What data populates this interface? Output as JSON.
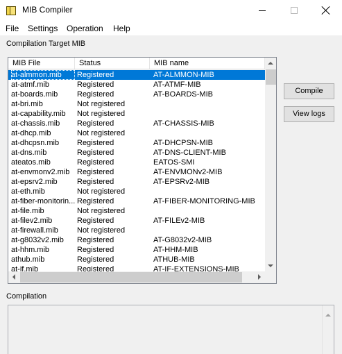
{
  "window": {
    "title": "MIB Compiler",
    "app_icon": "mib-compiler-icon",
    "controls": [
      "minimize-icon",
      "maximize-icon",
      "close-icon"
    ]
  },
  "menu": [
    "File",
    "Settings",
    "Operation",
    "Help"
  ],
  "target_label": "Compilation Target MIB",
  "table": {
    "columns": [
      "MIB File",
      "Status",
      "MIB name"
    ],
    "selected_index": 0,
    "rows": [
      {
        "file": "at-almmon.mib",
        "status": "Registered",
        "name": "AT-ALMMON-MIB"
      },
      {
        "file": "at-atmf.mib",
        "status": "Registered",
        "name": "AT-ATMF-MIB"
      },
      {
        "file": "at-boards.mib",
        "status": "Registered",
        "name": "AT-BOARDS-MIB"
      },
      {
        "file": "at-bri.mib",
        "status": "Not registered",
        "name": ""
      },
      {
        "file": "at-capability.mib",
        "status": "Not registered",
        "name": ""
      },
      {
        "file": "at-chassis.mib",
        "status": "Registered",
        "name": "AT-CHASSIS-MIB"
      },
      {
        "file": "at-dhcp.mib",
        "status": "Not registered",
        "name": ""
      },
      {
        "file": "at-dhcpsn.mib",
        "status": "Registered",
        "name": "AT-DHCPSN-MIB"
      },
      {
        "file": "at-dns.mib",
        "status": "Registered",
        "name": "AT-DNS-CLIENT-MIB"
      },
      {
        "file": "ateatos.mib",
        "status": "Registered",
        "name": "EATOS-SMI"
      },
      {
        "file": "at-envmonv2.mib",
        "status": "Registered",
        "name": "AT-ENVMONv2-MIB"
      },
      {
        "file": "at-epsrv2.mib",
        "status": "Registered",
        "name": "AT-EPSRv2-MIB"
      },
      {
        "file": "at-eth.mib",
        "status": "Not registered",
        "name": ""
      },
      {
        "file": "at-fiber-monitorin...",
        "status": "Registered",
        "name": "AT-FIBER-MONITORING-MIB"
      },
      {
        "file": "at-file.mib",
        "status": "Not registered",
        "name": ""
      },
      {
        "file": "at-filev2.mib",
        "status": "Registered",
        "name": "AT-FILEv2-MIB"
      },
      {
        "file": "at-firewall.mib",
        "status": "Not registered",
        "name": ""
      },
      {
        "file": "at-g8032v2.mib",
        "status": "Registered",
        "name": "AT-G8032v2-MIB"
      },
      {
        "file": "at-hhm.mib",
        "status": "Registered",
        "name": "AT-HHM-MIB"
      },
      {
        "file": "athub.mib",
        "status": "Registered",
        "name": "ATHUB-MIB"
      },
      {
        "file": "at-if.mib",
        "status": "Registered",
        "name": "AT-IF-EXTENSIONS-MIB"
      }
    ]
  },
  "buttons": {
    "compile": "Compile",
    "view_logs": "View logs"
  },
  "compilation_label": "Compilation"
}
